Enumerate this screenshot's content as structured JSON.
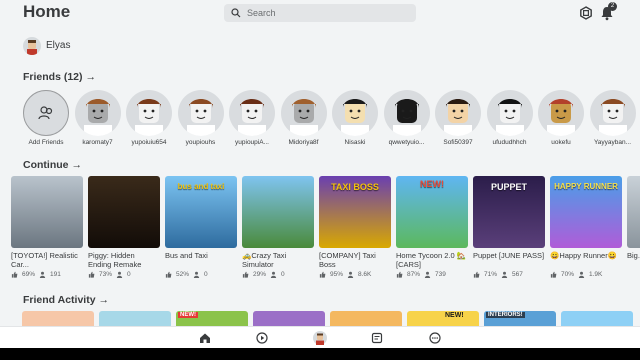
{
  "header": {
    "title": "Home",
    "search_placeholder": "Search",
    "notification_count": "2"
  },
  "user": {
    "name": "Elyas"
  },
  "friends": {
    "title": "Friends (12)",
    "chevron": "→",
    "add_label": "Add Friends",
    "items": [
      {
        "name": "karomaty7"
      },
      {
        "name": "yupoiuiu654"
      },
      {
        "name": "youpiouhs"
      },
      {
        "name": "yupioupiA..."
      },
      {
        "name": "Midoriya8f"
      },
      {
        "name": "Nisaski"
      },
      {
        "name": "qwwetyuio..."
      },
      {
        "name": "Sofi50397"
      },
      {
        "name": "ufududhhch"
      },
      {
        "name": "uokefu"
      },
      {
        "name": "Yayyayban..."
      }
    ]
  },
  "continue": {
    "title": "Continue",
    "chevron": "→",
    "games": [
      {
        "title": "[TOYOTA!] Realistic Car...",
        "rating": "69%",
        "players": "191",
        "thumb_text": ""
      },
      {
        "title": "Piggy: Hidden Ending Remake",
        "rating": "73%",
        "players": "0",
        "thumb_text": ""
      },
      {
        "title": "Bus and Taxi",
        "rating": "52%",
        "players": "0",
        "thumb_text": "bus and taxi"
      },
      {
        "title": "🚕Crazy Taxi Simulator",
        "rating": "29%",
        "players": "0",
        "thumb_text": ""
      },
      {
        "title": "[COMPANY] Taxi Boss",
        "rating": "95%",
        "players": "8.6K",
        "thumb_text": "TAXI BOSS"
      },
      {
        "title": "Home Tycoon 2.0 🏡 [CARS]",
        "rating": "87%",
        "players": "739",
        "thumb_text": "NEW!"
      },
      {
        "title": "Puppet [JUNE PASS]",
        "rating": "71%",
        "players": "567",
        "thumb_text": "PUPPET"
      },
      {
        "title": "😀Happy Runner😀",
        "rating": "70%",
        "players": "1.9K",
        "thumb_text": "HAPPY RUNNER"
      },
      {
        "title": "Big...",
        "rating": "",
        "players": "",
        "thumb_text": ""
      }
    ]
  },
  "activity": {
    "title": "Friend Activity",
    "chevron": "→",
    "badge_new": "NEW!",
    "badge_interiors": "INTERIORS!"
  },
  "colors": {
    "background": "#f2f4f5",
    "text": "#393b3d",
    "nav_bg": "#ffffff"
  }
}
